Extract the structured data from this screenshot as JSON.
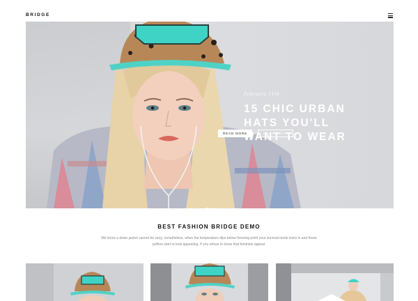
{
  "header": {
    "logo": "BRIDGE",
    "menu_icon": "hamburger-menu-icon"
  },
  "hero": {
    "date": "February 11th",
    "headline_lines": [
      "15 CHIC URBAN",
      "HATS YOU'LL",
      "WANT TO WEAR"
    ],
    "primary_button": "READ MORE",
    "secondary_button": "READ MORE",
    "slides": 3,
    "active_slide": 1
  },
  "section": {
    "title": "BEST FASHION BRIDGE DEMO",
    "description": "We know a down jacket cannot be sexy; nonetheless, when the temperature dips below freezing point your survival mode kicks in and those puffers start to look appealing. If you refuse to loose that feminine appeal."
  },
  "colors": {
    "accent_cap": "#3fd3c6",
    "text_dark": "#111111",
    "text_muted": "#888888"
  }
}
